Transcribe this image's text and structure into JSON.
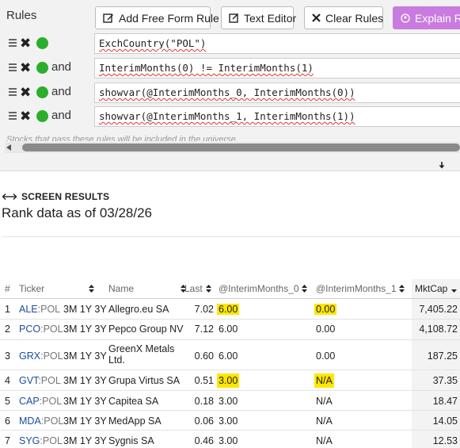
{
  "rules_panel": {
    "title": "Rules",
    "buttons": {
      "add_free_form": "Add Free Form Rule",
      "text_editor": "Text Editor",
      "clear_rules": "Clear Rules",
      "explain": "Explain Rule"
    },
    "rules": [
      {
        "conjunction": "",
        "formula": "ExchCountry(\"POL\")"
      },
      {
        "conjunction": "and",
        "formula": "InterimMonths(0) != InterimMonths(1)"
      },
      {
        "conjunction": "and",
        "formula": "showvar(@InterimMonths_0, InterimMonths(0))"
      },
      {
        "conjunction": "and",
        "formula": "showvar(@InterimMonths_1, InterimMonths(1))"
      }
    ],
    "note": "Stocks that pass these rules will be included in the universe."
  },
  "results": {
    "section_title": "SCREEN RESULTS",
    "rank_prefix": "Rank data as of",
    "rank_date": "03/28/26",
    "columns": [
      "#",
      "Ticker",
      "Name",
      "Last",
      "@InterimMonths_0",
      "@InterimMonths_1",
      "MktCap"
    ],
    "periods_label": "3M 1Y 3Y",
    "rows": [
      {
        "num": "1",
        "sym": "ALE",
        "exch": ":POL",
        "name": "Allegro.eu SA",
        "last": "7.02",
        "im0": "6.00",
        "im1": "0.00",
        "mktcap": "7,405.22",
        "hl0": true,
        "hl1": true
      },
      {
        "num": "2",
        "sym": "PCO",
        "exch": ":POL",
        "name": "Pepco Group NV",
        "last": "7.12",
        "im0": "6.00",
        "im1": "0.00",
        "mktcap": "4,108.72",
        "hl0": false,
        "hl1": false
      },
      {
        "num": "3",
        "sym": "GRX",
        "exch": ":POL",
        "name": "GreenX Metals Ltd.",
        "last": "0.60",
        "im0": "6.00",
        "im1": "0.00",
        "mktcap": "187.25",
        "hl0": false,
        "hl1": false
      },
      {
        "num": "4",
        "sym": "GVT",
        "exch": ":POL",
        "name": "Grupa Virtus SA",
        "last": "0.51",
        "im0": "3.00",
        "im1": "N/A",
        "mktcap": "37.35",
        "hl0": true,
        "hl1": true
      },
      {
        "num": "5",
        "sym": "CAP",
        "exch": ":POL",
        "name": "Capitea SA",
        "last": "0.18",
        "im0": "3.00",
        "im1": "N/A",
        "mktcap": "18.47",
        "hl0": false,
        "hl1": false
      },
      {
        "num": "6",
        "sym": "MDA",
        "exch": ":POL",
        "name": "MedApp SA",
        "last": "0.06",
        "im0": "3.00",
        "im1": "N/A",
        "mktcap": "14.05",
        "hl0": false,
        "hl1": false
      },
      {
        "num": "7",
        "sym": "SYG",
        "exch": ":POL",
        "name": "Sygnis SA",
        "last": "0.46",
        "im0": "3.00",
        "im1": "N/A",
        "mktcap": "12.53",
        "hl0": false,
        "hl1": false
      }
    ]
  },
  "colors": {
    "rule_active_dot": "#2bae2b",
    "explain_button": "#c97be0",
    "ticker_link": "#1a4fa0",
    "highlight": "#ffe600"
  }
}
